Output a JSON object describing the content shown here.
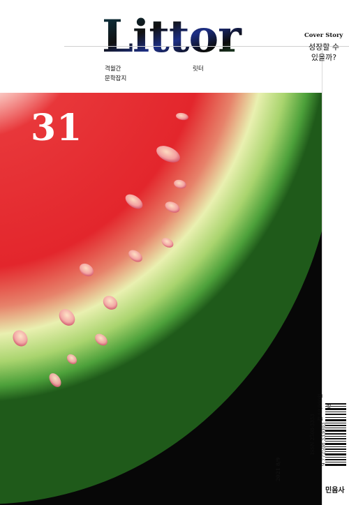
{
  "masthead": {
    "title": "Littor"
  },
  "subtitles": {
    "frequency": "격월간",
    "genre": "문학잡지",
    "name_korean": "릿터"
  },
  "cover_story": {
    "kicker": "Cover Story",
    "title_line1": "성장할 수",
    "title_line2": "있을까?"
  },
  "issue": {
    "number": "31",
    "date": "2021 8/9"
  },
  "publication": {
    "issn": "ISSN 2508-3333",
    "price": "값 10,000원",
    "barcode_digits": "9 772508 333003",
    "barcode_addon": "08",
    "publisher": "민음사"
  },
  "colors": {
    "flesh_red": "#e3262c",
    "core_white": "#fff6f2",
    "rind_light": "#e9f0b0",
    "rind_green": "#3f9b2e",
    "background_black": "#070707",
    "seed": "#f2b6b2"
  },
  "icons": {
    "logo": "littor-wordmark",
    "art": "watermelon-slice-illustration",
    "barcode": "barcode-icon"
  }
}
